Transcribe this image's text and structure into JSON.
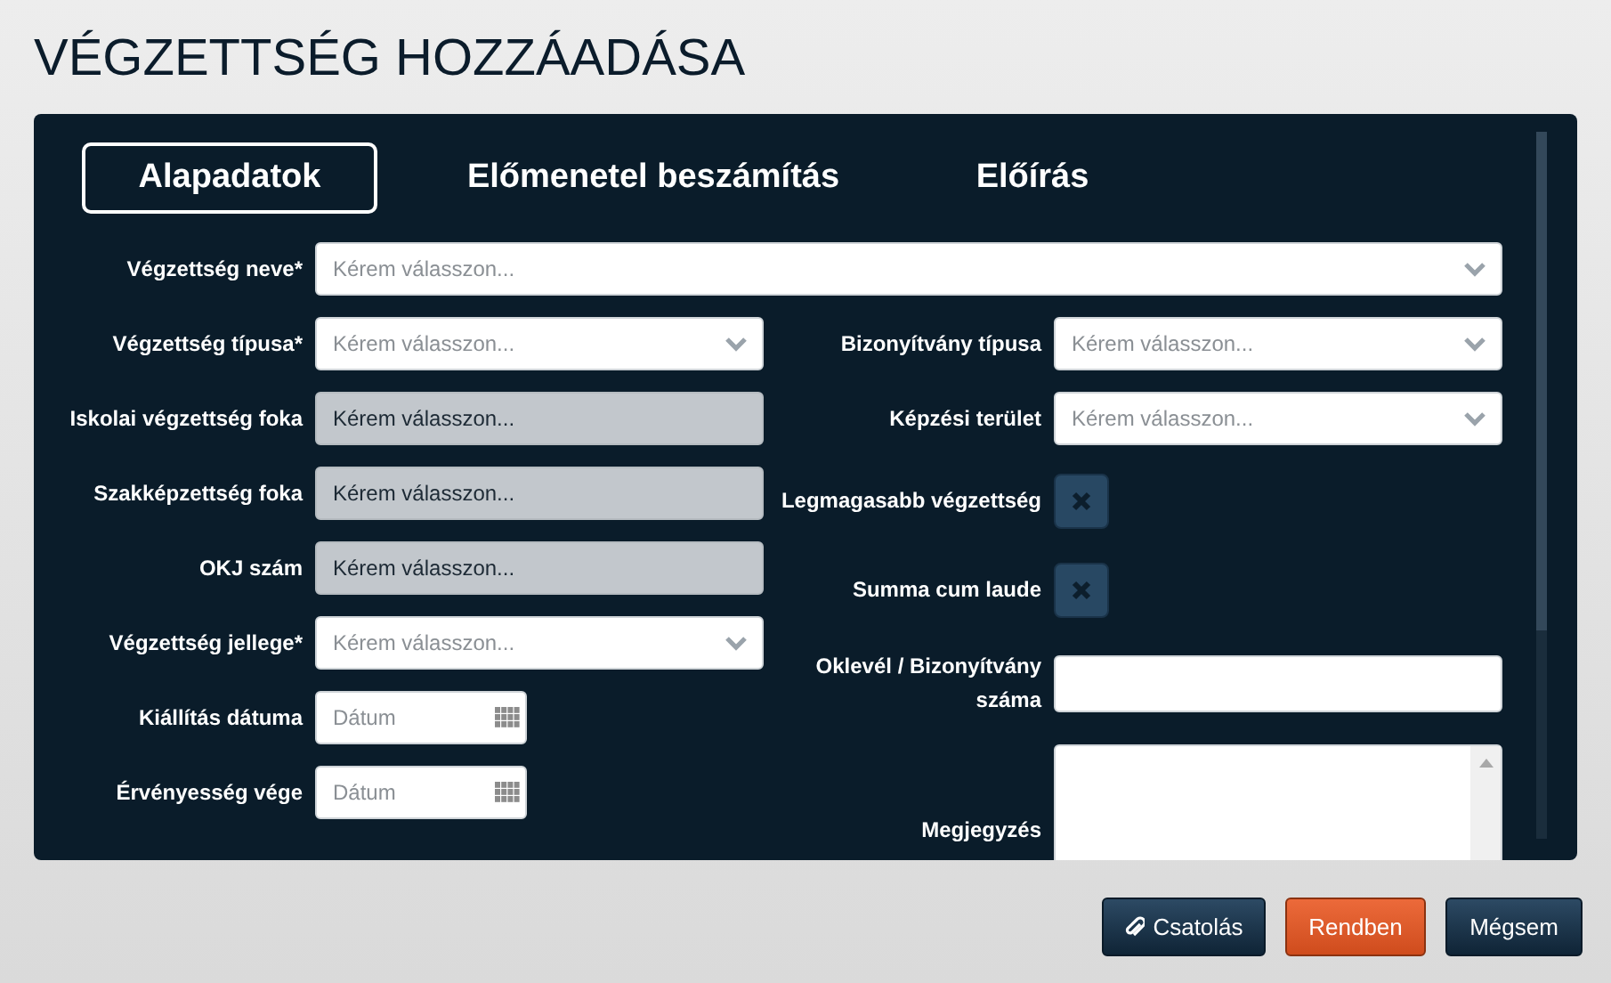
{
  "title": "VÉGZETTSÉG HOZZÁADÁSA",
  "tabs": [
    {
      "label": "Alapadatok",
      "selected": true
    },
    {
      "label": "Előmenetel beszámítás",
      "selected": false
    },
    {
      "label": "Előírás",
      "selected": false
    }
  ],
  "name_field": {
    "kind": "select",
    "label": "Végzettség neve*",
    "placeholder": "Kérem válasszon...",
    "disabled": false
  },
  "left_fields": [
    {
      "kind": "select",
      "label": "Végzettség típusa*",
      "placeholder": "Kérem válasszon...",
      "disabled": false
    },
    {
      "kind": "select",
      "label": "Iskolai végzettség foka",
      "placeholder": "Kérem válasszon...",
      "disabled": true
    },
    {
      "kind": "select",
      "label": "Szakképzettség foka",
      "placeholder": "Kérem válasszon...",
      "disabled": true
    },
    {
      "kind": "select",
      "label": "OKJ szám",
      "placeholder": "Kérem válasszon...",
      "disabled": true
    },
    {
      "kind": "select",
      "label": "Végzettség jellege*",
      "placeholder": "Kérem válasszon...",
      "disabled": false
    },
    {
      "kind": "date",
      "label": "Kiállítás dátuma",
      "placeholder": "Dátum"
    },
    {
      "kind": "date",
      "label": "Érvényesség vége",
      "placeholder": "Dátum"
    }
  ],
  "right_fields": [
    {
      "kind": "select",
      "label": "Bizonyítvány típusa",
      "placeholder": "Kérem válasszon...",
      "disabled": false
    },
    {
      "kind": "select",
      "label": "Képzési terület",
      "placeholder": "Kérem válasszon...",
      "disabled": false
    },
    {
      "kind": "checkbox",
      "label": "Legmagasabb végzettség",
      "checked": false
    },
    {
      "kind": "checkbox",
      "label": "Summa cum laude",
      "checked": false
    },
    {
      "kind": "text",
      "label": "Oklevél / Bizonyítvány száma"
    },
    {
      "kind": "textarea",
      "label": "Megjegyzés"
    }
  ],
  "buttons": [
    {
      "kind": "attach",
      "label": "Csatolás"
    },
    {
      "kind": "primary",
      "label": "Rendben"
    },
    {
      "kind": "secondary",
      "label": "Mégsem"
    }
  ]
}
